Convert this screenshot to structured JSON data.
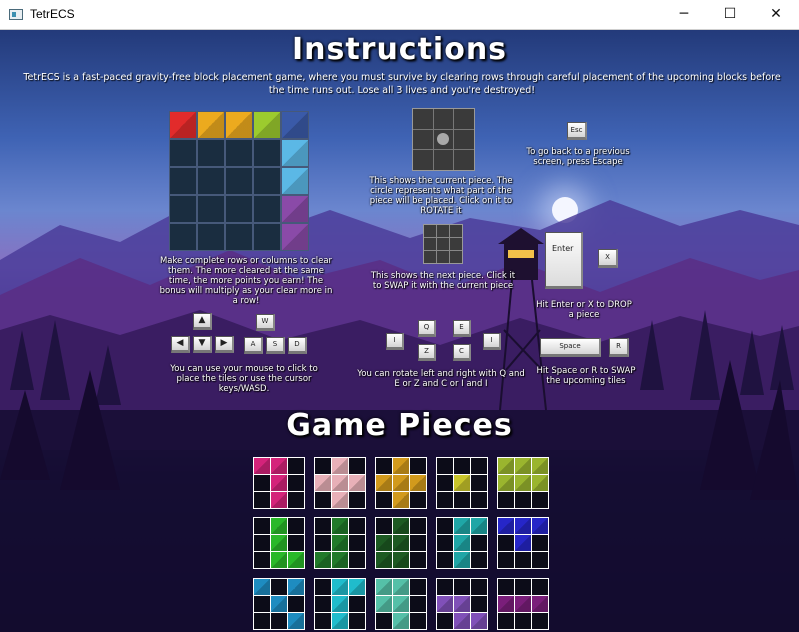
{
  "window": {
    "title": "TetrECS",
    "minimize": "─",
    "maximize": "☐",
    "close": "✕"
  },
  "instructions": {
    "heading": "Instructions",
    "intro": "TetrECS is a fast-paced gravity-free block placement game, where you must survive by clearing rows through careful placement of the upcoming blocks before the time runs out. Lose all 3 lives and you're destroyed!",
    "board_caption": "Make complete rows or columns to clear them. The more cleared at the same time, the more points you earn! The bonus will multiply as your clear more in a row!",
    "current_caption": "This shows the current piece. The circle represents what part of the piece will be placed. Click on it to ROTATE it",
    "next_caption": "This shows the next piece. Click it to SWAP it with the current piece",
    "escape_caption": "To go back to a previous screen, press Escape",
    "drop_caption": "Hit Enter or X to DROP a piece",
    "mouse_caption": "You can use your mouse to click to place the tiles or use the cursor keys/WASD.",
    "rotate_caption": "You can rotate left and right with Q and E or Z and C or I and I",
    "swap_caption": "Hit Space or R to SWAP the upcoming tiles"
  },
  "keys": {
    "esc": "Esc",
    "enter": "Enter",
    "x": "X",
    "w": "W",
    "a": "A",
    "s": "S",
    "d": "D",
    "up": "▲",
    "down": "▼",
    "left": "◀",
    "right": "▶",
    "q": "Q",
    "e": "E",
    "z": "Z",
    "c": "C",
    "i_left": "I",
    "i_right": "I",
    "space": "Space",
    "r": "R"
  },
  "game_pieces": {
    "heading": "Game Pieces"
  },
  "colors": {
    "demo_top_row": [
      "#e22b2b",
      "#ecaa1e",
      "#ecaa1e",
      "#9ccb2e",
      "#3a5aa8"
    ],
    "demo_right_col": [
      "#3a5aa8",
      "#5bb8e6",
      "#5bb8e6",
      "#8a4aa8",
      "#8a4aa8"
    ],
    "empty": "#0c0c18",
    "pieces": [
      [
        "#d4237a",
        "#d4237a",
        "#d4237a"
      ],
      [
        "#e8b0b8"
      ],
      [
        "#d29a1c"
      ],
      [
        "#c9c52a"
      ],
      [
        "#9ab52e"
      ],
      [
        "#29b829"
      ],
      [
        "#217a2a"
      ],
      [
        "#1d5a22"
      ],
      [
        "#1fa6a6"
      ],
      [
        "#2626c8"
      ],
      [
        "#1e8cc0"
      ],
      [
        "#20bccc"
      ],
      [
        "#55c0a8"
      ],
      [
        "#8050b8"
      ],
      [
        "#7a1e7a"
      ]
    ]
  }
}
